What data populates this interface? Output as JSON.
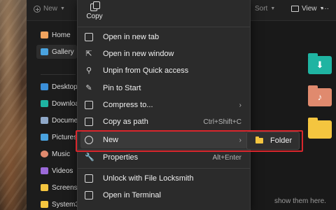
{
  "toolbar": {
    "new_label": "New",
    "sort_label": "Sort",
    "view_label": "View",
    "more_label": "···"
  },
  "nav": {
    "items": [
      {
        "label": "Home",
        "icon": "home-icon",
        "color": "#f0a35e"
      },
      {
        "label": "Gallery",
        "icon": "gallery-icon",
        "color": "#4aa3df"
      },
      {
        "label": "Desktop",
        "icon": "desktop-icon",
        "color": "#3b8fd9"
      },
      {
        "label": "Downloads",
        "icon": "downloads-icon",
        "color": "#1fb4a2"
      },
      {
        "label": "Documents",
        "icon": "documents-icon",
        "color": "#8fa8c8"
      },
      {
        "label": "Pictures",
        "icon": "pictures-icon",
        "color": "#4aa3df"
      },
      {
        "label": "Music",
        "icon": "music-icon",
        "color": "#e08a6e"
      },
      {
        "label": "Videos",
        "icon": "videos-icon",
        "color": "#9b6ad9"
      },
      {
        "label": "Screensh",
        "icon": "folder-icon",
        "color": "#f4c53f"
      },
      {
        "label": "System3",
        "icon": "folder-icon",
        "color": "#f4c53f"
      }
    ]
  },
  "context_menu": {
    "copy_label": "Copy",
    "items": [
      {
        "label": "Open in new tab",
        "icon": "open-new-tab-icon"
      },
      {
        "label": "Open in new window",
        "icon": "open-new-window-icon"
      },
      {
        "label": "Unpin from Quick access",
        "icon": "unpin-icon"
      },
      {
        "label": "Pin to Start",
        "icon": "pin-icon"
      },
      {
        "label": "Compress to...",
        "icon": "compress-icon",
        "submenu": "›"
      },
      {
        "label": "Copy as path",
        "icon": "copy-path-icon",
        "accelerator": "Ctrl+Shift+C"
      },
      {
        "label": "New",
        "icon": "new-icon",
        "submenu": "›"
      },
      {
        "label": "Properties",
        "icon": "properties-icon",
        "accelerator": "Alt+Enter"
      },
      {
        "label": "Unlock with File Locksmith",
        "icon": "lock-icon"
      },
      {
        "label": "Open in Terminal",
        "icon": "terminal-icon"
      }
    ]
  },
  "submenu": {
    "items": [
      {
        "label": "Folder",
        "icon": "folder-icon"
      }
    ]
  },
  "content": {
    "empty_hint": "show them here."
  },
  "colors": {
    "highlight_border": "#d9262c",
    "folder_yellow": "#f4c53f",
    "downloads_teal": "#1fb4a2",
    "music_salmon": "#e08a6e"
  }
}
